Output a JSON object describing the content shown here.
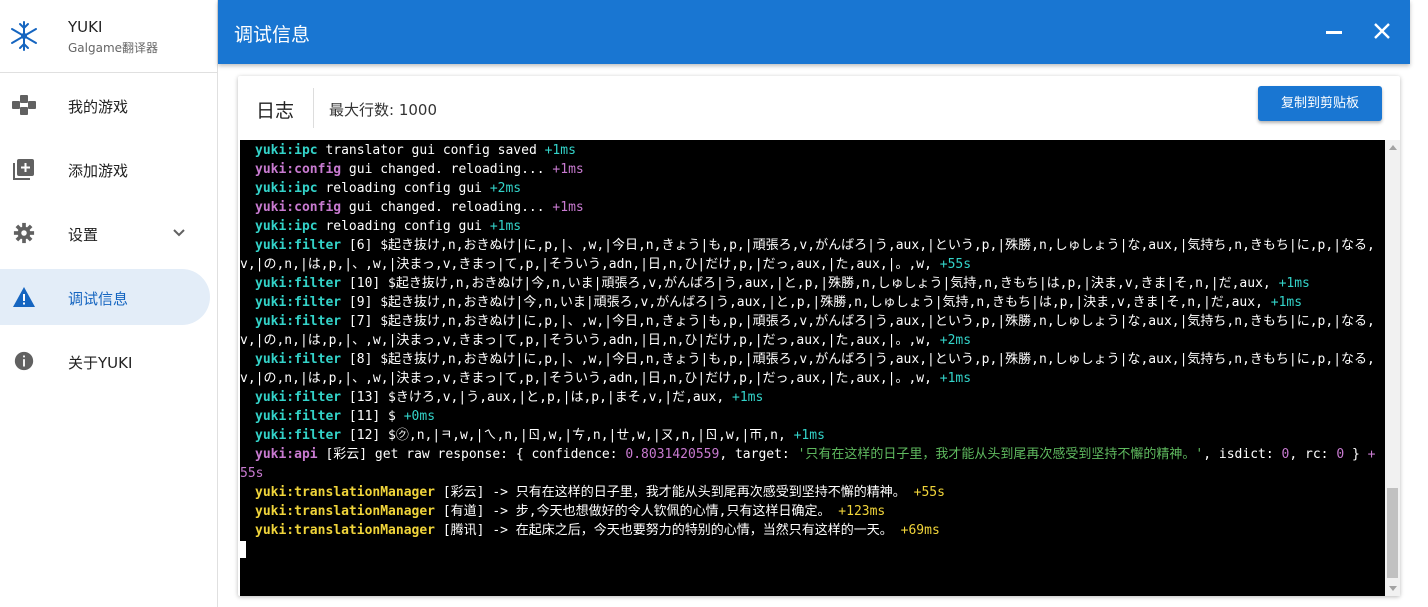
{
  "app": {
    "name": "YUKI",
    "subtitle": "Galgame翻译器"
  },
  "sidebar": {
    "items": [
      {
        "label": "我的游戏",
        "icon": "gamepad-icon"
      },
      {
        "label": "添加游戏",
        "icon": "add-box-icon"
      },
      {
        "label": "设置",
        "icon": "gear-icon"
      },
      {
        "label": "调试信息",
        "icon": "warning-icon",
        "active": true
      },
      {
        "label": "关于YUKI",
        "icon": "info-icon"
      }
    ]
  },
  "header": {
    "title": "调试信息"
  },
  "card": {
    "title": "日志",
    "meta": "最大行数: 1000",
    "copy_label": "复制到剪贴板"
  },
  "colors": {
    "primary": "#1976d2",
    "console_bg": "#000000",
    "ns_cyan": "#33d3c9",
    "ns_purple": "#c87ad0",
    "ns_yellow": "#f0d43a",
    "string_green": "#5fba5f"
  },
  "log": [
    {
      "ns": "yuki:ipc",
      "msg": "translator gui config saved",
      "delta": "+1ms"
    },
    {
      "ns": "yuki:config",
      "msg": "gui changed. reloading...",
      "delta": "+1ms"
    },
    {
      "ns": "yuki:ipc",
      "msg": "reloading config gui",
      "delta": "+2ms"
    },
    {
      "ns": "yuki:config",
      "msg": "gui changed. reloading...",
      "delta": "+1ms"
    },
    {
      "ns": "yuki:ipc",
      "msg": "reloading config gui",
      "delta": "+1ms"
    },
    {
      "ns": "yuki:filter",
      "msg": "[6] $起き抜け,n,おきぬけ|に,p,|、,w,|今日,n,きょう|も,p,|頑張ろ,v,がんばろ|う,aux,|という,p,|殊勝,n,しゅしょう|な,aux,|気持ち,n,きもち|に,p,|なる,v,|の,n,|は,p,|、,w,|決まっ,v,きまっ|て,p,|そういう,adn,|日,n,ひ|だけ,p,|だっ,aux,|た,aux,|。,w,",
      "delta": "+55s"
    },
    {
      "ns": "yuki:filter",
      "msg": "[10] $起き抜け,n,おきぬけ|今,n,いま|頑張ろ,v,がんばろ|う,aux,|と,p,|殊勝,n,しゅしょう|気持,n,きもち|は,p,|決ま,v,きま|そ,n,|だ,aux,",
      "delta": "+1ms"
    },
    {
      "ns": "yuki:filter",
      "msg": "[9] $起き抜け,n,おきぬけ|今,n,いま|頑張ろ,v,がんばろ|う,aux,|と,p,|殊勝,n,しゅしょう|気持,n,きもち|は,p,|決ま,v,きま|そ,n,|だ,aux,",
      "delta": "+1ms"
    },
    {
      "ns": "yuki:filter",
      "msg": "[7] $起き抜け,n,おきぬけ|に,p,|、,w,|今日,n,きょう|も,p,|頑張ろ,v,がんばろ|う,aux,|という,p,|殊勝,n,しゅしょう|な,aux,|気持ち,n,きもち|に,p,|なる,v,|の,n,|は,p,|、,w,|決まっ,v,きまっ|て,p,|そういう,adn,|日,n,ひ|だけ,p,|だっ,aux,|た,aux,|。,w,",
      "delta": "+2ms"
    },
    {
      "ns": "yuki:filter",
      "msg": "[8] $起き抜け,n,おきぬけ|に,p,|、,w,|今日,n,きょう|も,p,|頑張ろ,v,がんばろ|う,aux,|という,p,|殊勝,n,しゅしょう|な,aux,|気持ち,n,きもち|に,p,|なる,v,|の,n,|は,p,|、,w,|決まっ,v,きまっ|て,p,|そういう,adn,|日,n,ひ|だけ,p,|だっ,aux,|た,aux,|。,w,",
      "delta": "+1ms"
    },
    {
      "ns": "yuki:filter",
      "msg": "[13] $きけろ,v,|う,aux,|と,p,|は,p,|まそ,v,|だ,aux,",
      "delta": "+1ms"
    },
    {
      "ns": "yuki:filter",
      "msg": "[11] $",
      "delta": "+0ms"
    },
    {
      "ns": "yuki:filter",
      "msg": "[12] $㋗,n,|ㅋ,w,|ㄟ,n,|ㄖ,w,|ㄘ,n,|ㄝ,w,|ㄡ,n,|ㄖ,w,|ㄭ,n,",
      "delta": "+1ms"
    },
    {
      "ns": "yuki:api",
      "msg_parts": {
        "prefix": "[彩云] get raw response: { confidence: ",
        "confidence": "0.8031420559",
        "mid": ", target: ",
        "target": "'只有在这样的日子里，我才能从头到尾再次感受到坚持不懈的精神。'",
        "mid2": ", isdict: ",
        "isdict": "0",
        "mid3": ", rc: ",
        "rc": "0",
        "suffix": " }"
      },
      "delta": "+55s"
    },
    {
      "ns": "yuki:translationManager",
      "msg": "[彩云] -> 只有在这样的日子里，我才能从头到尾再次感受到坚持不懈的精神。",
      "delta": "+55s"
    },
    {
      "ns": "yuki:translationManager",
      "msg": "[有道] -> 步,今天也想做好的令人钦佩的心情,只有这样日确定。",
      "delta": "+123ms"
    },
    {
      "ns": "yuki:translationManager",
      "msg": "[腾讯] -> 在起床之后，今天也要努力的特别的心情，当然只有这样的一天。",
      "delta": "+69ms"
    }
  ]
}
